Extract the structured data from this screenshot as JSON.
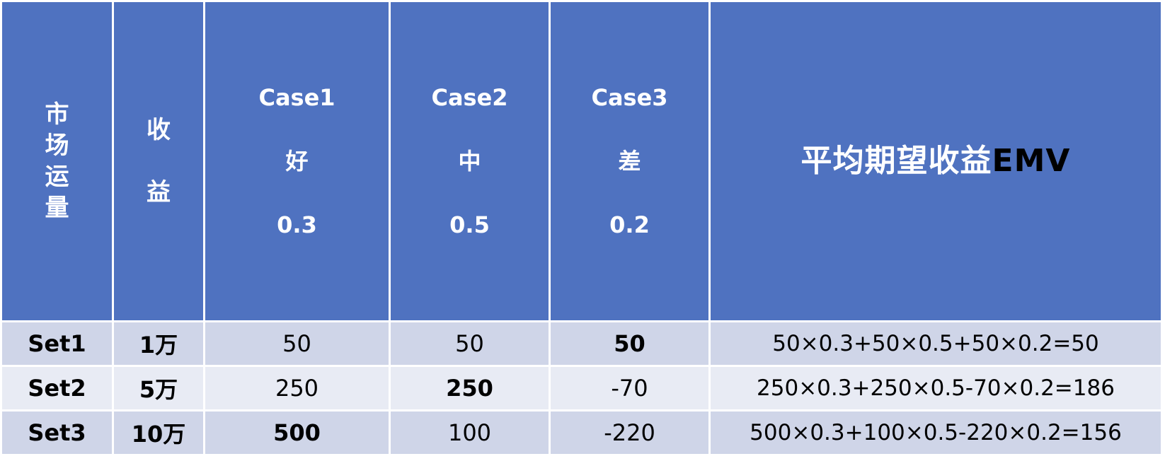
{
  "header": {
    "market_volume": "市\n场\n运\n量",
    "revenue": "收\n\n益",
    "cases": [
      {
        "name": "Case1",
        "label": "好",
        "prob": "0.3"
      },
      {
        "name": "Case2",
        "label": "中",
        "prob": "0.5"
      },
      {
        "name": "Case3",
        "label": "差",
        "prob": "0.2"
      }
    ],
    "emv_title": "平均期望收益",
    "emv_suffix": "EMV"
  },
  "rows": [
    {
      "set": "Set1",
      "volume": "1万",
      "case1": "50",
      "case2": "50",
      "case3": "50",
      "emv": "50×0.3+50×0.5+50×0.2=50"
    },
    {
      "set": "Set2",
      "volume": "5万",
      "case1": "250",
      "case2": "250",
      "case3": "-70",
      "emv": "250×0.3+250×0.5-70×0.2=186"
    },
    {
      "set": "Set3",
      "volume": "10万",
      "case1": "500",
      "case2": "100",
      "case3": "-220",
      "emv": "500×0.3+100×0.5-220×0.2=156"
    }
  ],
  "colors": {
    "header_bg": "#4f72c0",
    "row_odd_bg": "#cfd5e8",
    "row_even_bg": "#e8ebf4",
    "header_text": "#ffffff",
    "emv_suffix_text": "#000000"
  }
}
